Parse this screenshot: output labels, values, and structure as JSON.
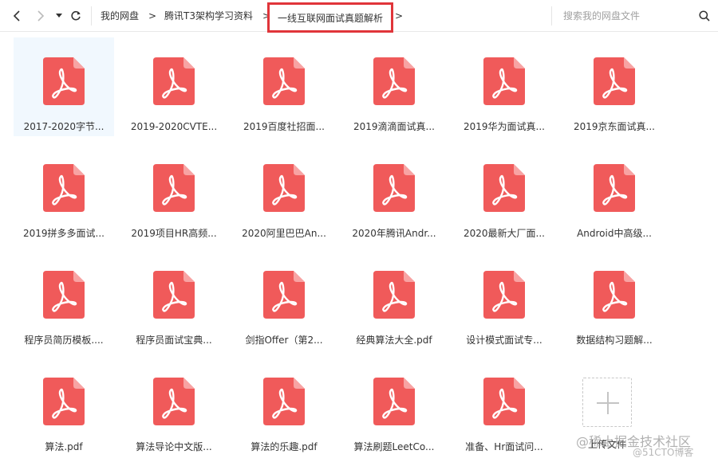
{
  "toolbar": {
    "breadcrumbs": [
      "我的网盘",
      "腾讯T3架构学习资料"
    ],
    "current_folder": "一线互联网面试真题解析",
    "search_placeholder": "搜索我的网盘文件"
  },
  "files": [
    {
      "name": "2017-2020字节...",
      "type": "pdf"
    },
    {
      "name": "2019-2020CVTE...",
      "type": "pdf"
    },
    {
      "name": "2019百度社招面...",
      "type": "pdf"
    },
    {
      "name": "2019滴滴面试真...",
      "type": "pdf"
    },
    {
      "name": "2019华为面试真...",
      "type": "pdf"
    },
    {
      "name": "2019京东面试真...",
      "type": "pdf"
    },
    {
      "name": "2019拼多多面试...",
      "type": "pdf"
    },
    {
      "name": "2019项目HR高频...",
      "type": "pdf"
    },
    {
      "name": "2020阿里巴巴An...",
      "type": "pdf"
    },
    {
      "name": "2020年腾讯Andr...",
      "type": "pdf"
    },
    {
      "name": "2020最新大厂面...",
      "type": "pdf"
    },
    {
      "name": "Android中高级...",
      "type": "pdf"
    },
    {
      "name": "程序员简历模板....",
      "type": "pdf"
    },
    {
      "name": "程序员面试宝典...",
      "type": "pdf"
    },
    {
      "name": "剑指Offer（第2...",
      "type": "pdf"
    },
    {
      "name": "经典算法大全.pdf",
      "type": "pdf"
    },
    {
      "name": "设计模式面试专...",
      "type": "pdf"
    },
    {
      "name": "数据结构习题解...",
      "type": "pdf"
    },
    {
      "name": "算法.pdf",
      "type": "pdf"
    },
    {
      "name": "算法导论中文版...",
      "type": "pdf"
    },
    {
      "name": "算法的乐趣.pdf",
      "type": "pdf"
    },
    {
      "name": "算法刷题LeetCo...",
      "type": "pdf"
    },
    {
      "name": "准备、Hr面试问...",
      "type": "pdf"
    }
  ],
  "upload_label": "上传文件",
  "watermark": {
    "line1": "@稀土掘金技术社区",
    "line2": "@51CTO博客"
  },
  "colors": {
    "pdf_red": "#f05a5a",
    "pdf_fold": "#f8a3a3",
    "highlight_border": "#e0353a",
    "selected_bg": "#f1f8fe"
  }
}
